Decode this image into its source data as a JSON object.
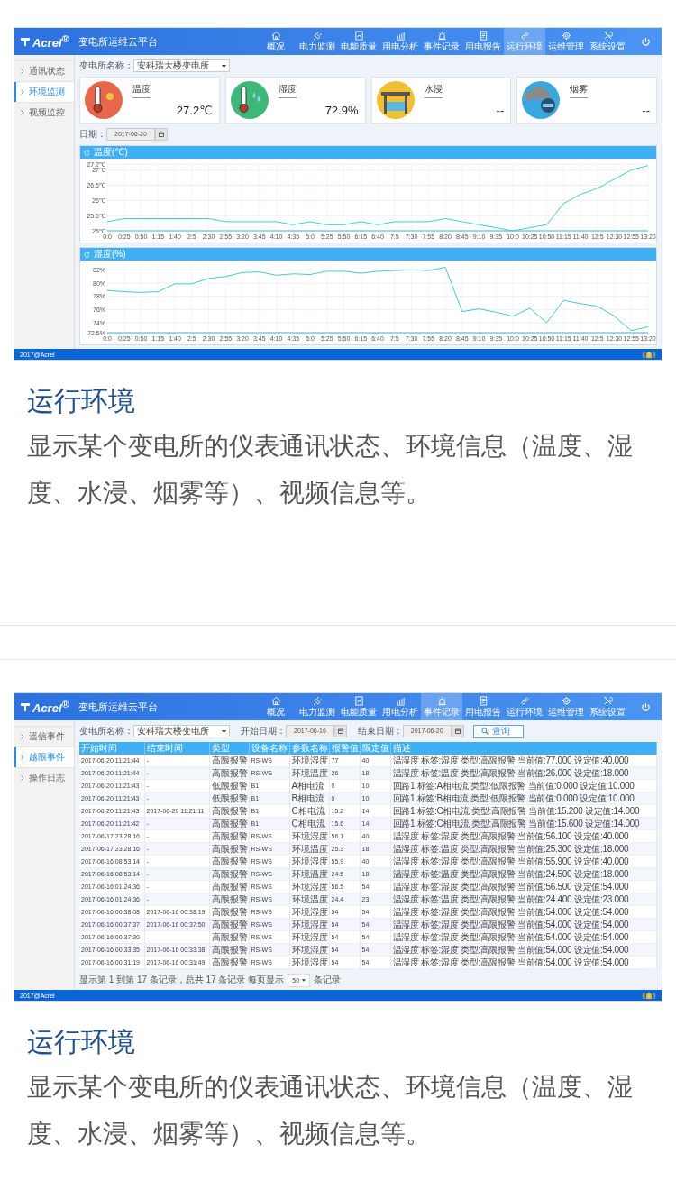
{
  "screenshot_1": {
    "logo": "Acrel$^{®}$",
    "title": "变电所运维云平台",
    "nav": [
      {
        "label": "概况",
        "selected": false
      },
      {
        "label": "电力监测",
        "selected": false
      },
      {
        "label": "电能质量",
        "selected": false
      },
      {
        "label": "用电分析",
        "selected": false
      },
      {
        "label": "事件记录",
        "selected": false
      },
      {
        "label": "用电报告",
        "selected": false
      },
      {
        "label": "运行环境",
        "selected": true
      },
      {
        "label": "运维管理",
        "selected": false
      },
      {
        "label": "系统设置",
        "selected": false
      }
    ],
    "sidebar": [
      {
        "label": "通讯状态",
        "selected": false
      },
      {
        "label": "环境监测",
        "selected": true
      },
      {
        "label": "视频监控",
        "selected": false
      }
    ],
    "filter": {
      "label": "变电所名称：",
      "value": "安科瑞大楼变电所"
    },
    "cards": [
      {
        "kind": "temperature",
        "label": "温度",
        "value": "27.2℃"
      },
      {
        "kind": "humidity",
        "label": "湿度",
        "value": "72.9%"
      },
      {
        "kind": "water",
        "label": "水浸",
        "value": "--"
      },
      {
        "kind": "smoke",
        "label": "烟雾",
        "value": "--"
      }
    ],
    "date": {
      "label": "日期：",
      "value": "2017-06-20"
    },
    "charts": [
      {
        "chart_data": {
          "type": "line",
          "grid": true,
          "title": "温度(℃)",
          "categories": [
            "0:0",
            "0:25",
            "0:50",
            "1:15",
            "1:40",
            "2:5",
            "2:30",
            "2:55",
            "3:20",
            "3:45",
            "4:10",
            "4:35",
            "5:0",
            "5:25",
            "5:50",
            "6:15",
            "6:40",
            "7:5",
            "7:30",
            "7:55",
            "8:20",
            "8:45",
            "9:10",
            "9:35",
            "10:0",
            "10:25",
            "10:50",
            "11:15",
            "11:40",
            "12:5",
            "12:30",
            "12:55",
            "13:20"
          ],
          "ylim": [
            25,
            27.2
          ],
          "yticks": [
            {
              "value": 25,
              "label": "25℃"
            },
            {
              "value": 25.5,
              "label": "25.5℃"
            },
            {
              "value": 26,
              "label": "26℃"
            },
            {
              "value": 26.5,
              "label": "26.5℃"
            },
            {
              "value": 27,
              "label": "27℃"
            },
            {
              "value": 27.2,
              "label": "27.2℃"
            }
          ],
          "series": [
            {
              "color": "#45cccc",
              "values": [
                25.3,
                25.4,
                25.4,
                25.4,
                25.4,
                25.4,
                25.4,
                25.3,
                25.3,
                25.3,
                25.3,
                25.2,
                25.3,
                25.2,
                25.2,
                25.3,
                25.2,
                25.3,
                25.3,
                25.3,
                25.4,
                25.3,
                25.2,
                25.1,
                25.0,
                25.1,
                25.2,
                25.9,
                26.2,
                26.4,
                26.7,
                27.0,
                27.15
              ]
            }
          ]
        }
      },
      {
        "chart_data": {
          "type": "line",
          "grid": true,
          "title": "湿度(%)",
          "categories": [
            "0:0",
            "0:25",
            "0:50",
            "1:15",
            "1:40",
            "2:5",
            "2:30",
            "2:55",
            "3:20",
            "3:45",
            "4:10",
            "4:35",
            "5:0",
            "5:25",
            "5:50",
            "6:15",
            "6:40",
            "7:5",
            "7:30",
            "7:55",
            "8:20",
            "8:45",
            "9:10",
            "9:35",
            "10:0",
            "10:25",
            "10:50",
            "11:15",
            "11:40",
            "12:5",
            "12:30",
            "12:55",
            "13:20"
          ],
          "ylim": [
            72.5,
            82.6
          ],
          "yticks": [
            {
              "value": 72.5,
              "label": "72.5%"
            },
            {
              "value": 74,
              "label": "74%"
            },
            {
              "value": 76,
              "label": "76%"
            },
            {
              "value": 78,
              "label": "78%"
            },
            {
              "value": 80,
              "label": "80%"
            },
            {
              "value": 82,
              "label": "82%"
            }
          ],
          "series": [
            {
              "color": "#45cccc",
              "values": [
                78.9,
                78.7,
                78.6,
                78.7,
                79.9,
                79.9,
                80.7,
                81.0,
                81.6,
                81.7,
                81.2,
                81.4,
                81.3,
                81.8,
                81.8,
                81.5,
                81.8,
                81.9,
                82.0,
                81.9,
                82.4,
                75.7,
                76.1,
                75.6,
                75.0,
                76.2,
                74.0,
                77.4,
                76.9,
                76.5,
                75.0,
                72.8,
                73.4
              ]
            }
          ]
        }
      }
    ],
    "footer": "2017@Acrel"
  },
  "caption_1": {
    "title": "运行环境",
    "text": "显示某个变电所的仪表通讯状态、环境信息（温度、湿度、水浸、烟雾等）、视频信息等。"
  },
  "screenshot_2": {
    "logo": "Acrel$^{®}$",
    "title": "变电所运维云平台",
    "nav": [
      {
        "label": "概况",
        "selected": false
      },
      {
        "label": "电力监测",
        "selected": false
      },
      {
        "label": "电能质量",
        "selected": false
      },
      {
        "label": "用电分析",
        "selected": false
      },
      {
        "label": "事件记录",
        "selected": true
      },
      {
        "label": "用电报告",
        "selected": false
      },
      {
        "label": "运行环境",
        "selected": false
      },
      {
        "label": "运维管理",
        "selected": false
      },
      {
        "label": "系统设置",
        "selected": false
      }
    ],
    "sidebar": [
      {
        "label": "遥信事件",
        "selected": false
      },
      {
        "label": "越限事件",
        "selected": true
      },
      {
        "label": "操作日志",
        "selected": false
      }
    ],
    "filter": {
      "label": "变电所名称：",
      "value": "安科瑞大楼变电所"
    },
    "start_date": {
      "label": "开始日期：",
      "value": "2017-06-16"
    },
    "end_date": {
      "label": "结束日期：",
      "value": "2017-06-20"
    },
    "search_button": "查询",
    "table": {
      "columns": [
        "开始时间",
        "结束时间",
        "类型",
        "设备名称",
        "参数名称",
        "报警值",
        "限定值",
        "描述"
      ],
      "rows": [
        [
          "2017-06-20 11:21:44",
          "-",
          "高限报警",
          "RS-WS",
          "环境湿度",
          "77",
          "40",
          "温湿度 标签:湿度 类型:高限报警 当前值:77.000 设定值:40.000"
        ],
        [
          "2017-06-20 11:21:44",
          "-",
          "高限报警",
          "RS-WS",
          "环境温度",
          "26",
          "18",
          "温湿度 标签:温度 类型:高限报警 当前值:26.000 设定值:18.000"
        ],
        [
          "2017-06-20 11:21:43",
          "-",
          "低限报警",
          "B1",
          "A相电流",
          "0",
          "10",
          "回路1 标签:A相电流 类型:低限报警 当前值:0.000 设定值:10.000"
        ],
        [
          "2017-06-20 11:21:43",
          "-",
          "低限报警",
          "B1",
          "B相电流",
          "0",
          "10",
          "回路1 标签:B相电流 类型:低限报警 当前值:0.000 设定值:10.000"
        ],
        [
          "2017-06-20 11:21:43",
          "2017-06-20 11:21:11",
          "高限报警",
          "B1",
          "C相电流",
          "15.2",
          "14",
          "回路1 标签:C相电流 类型:高限报警 当前值:15.200 设定值:14.000"
        ],
        [
          "2017-06-20 11:21:42",
          "-",
          "高限报警",
          "B1",
          "C相电流",
          "15.6",
          "14",
          "回路1 标签:C相电流 类型:高限报警 当前值:15.600 设定值:14.000"
        ],
        [
          "2017-06-17 23:28:16",
          "-",
          "高限报警",
          "RS-WS",
          "环境湿度",
          "56.1",
          "40",
          "温湿度 标签:湿度 类型:高限报警 当前值:56.100 设定值:40.000"
        ],
        [
          "2017-06-17 23:28:16",
          "-",
          "高限报警",
          "RS-WS",
          "环境温度",
          "25.3",
          "18",
          "温湿度 标签:温度 类型:高限报警 当前值:25.300 设定值:18.000"
        ],
        [
          "2017-06-16 08:53:14",
          "-",
          "高限报警",
          "RS-WS",
          "环境湿度",
          "55.9",
          "40",
          "温湿度 标签:湿度 类型:高限报警 当前值:55.900 设定值:40.000"
        ],
        [
          "2017-06-16 08:53:14",
          "-",
          "高限报警",
          "RS-WS",
          "环境温度",
          "24.5",
          "18",
          "温湿度 标签:温度 类型:高限报警 当前值:24.500 设定值:18.000"
        ],
        [
          "2017-06-16 01:24:36",
          "-",
          "高限报警",
          "RS-WS",
          "环境湿度",
          "56.5",
          "54",
          "温湿度 标签:湿度 类型:高限报警 当前值:56.500 设定值:54.000"
        ],
        [
          "2017-06-16 01:24:36",
          "-",
          "高限报警",
          "RS-WS",
          "环境温度",
          "24.4",
          "23",
          "温湿度 标签:温度 类型:高限报警 当前值:24.400 设定值:23.000"
        ],
        [
          "2017-06-16 00:38:08",
          "2017-06-16 00:38:19",
          "高限报警",
          "RS-WS",
          "环境湿度",
          "54",
          "54",
          "温湿度 标签:湿度 类型:高限报警 当前值:54.000 设定值:54.000"
        ],
        [
          "2017-06-16 00:37:37",
          "2017-06-16 00:37:50",
          "高限报警",
          "RS-WS",
          "环境湿度",
          "54",
          "54",
          "温湿度 标签:湿度 类型:高限报警 当前值:54.000 设定值:54.000"
        ],
        [
          "2017-06-16 00:37:30",
          "-",
          "高限报警",
          "RS-WS",
          "环境湿度",
          "54",
          "54",
          "温湿度 标签:湿度 类型:高限报警 当前值:54.000 设定值:54.000"
        ],
        [
          "2017-06-16 00:33:35",
          "2017-06-16 00:33:38",
          "高限报警",
          "RS-WS",
          "环境湿度",
          "54",
          "54",
          "温湿度 标签:湿度 类型:高限报警 当前值:54.000 设定值:54.000"
        ],
        [
          "2017-06-16 00:31:19",
          "2017-06-16 00:31:49",
          "高限报警",
          "RS-WS",
          "环境湿度",
          "54",
          "54",
          "温湿度 标签:湿度 类型:高限报警 当前值:54.000 设定值:54.000"
        ]
      ]
    },
    "pagination": {
      "before": "显示第 1 到第 17 条记录，总共 17 条记录 每页显示",
      "per_page": "50",
      "after": "条记录"
    },
    "footer": "2017@Acrel"
  },
  "caption_2": {
    "title": "运行环境",
    "text": "显示某个变电所的仪表通讯状态、环境信息（温度、湿度、水浸、烟雾等）、视频信息等。"
  }
}
